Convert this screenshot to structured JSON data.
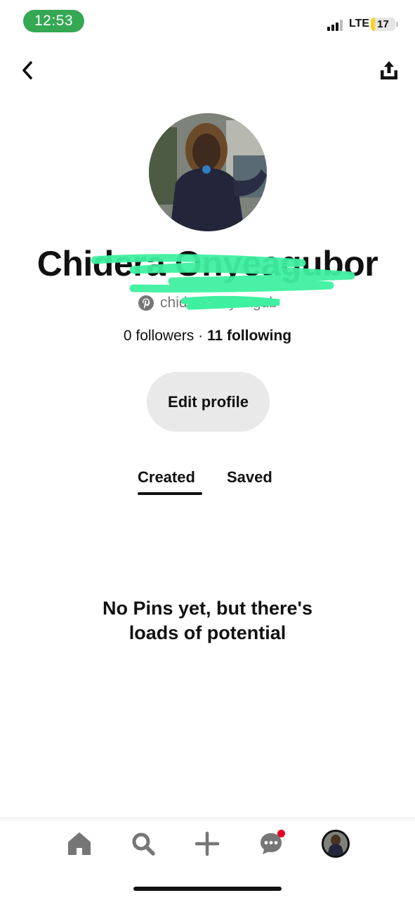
{
  "status_bar": {
    "time": "12:53",
    "network": "LTE",
    "battery_level": "17",
    "colors": {
      "time_pill": "#34a853",
      "battery_low": "#ffd21f"
    }
  },
  "header": {
    "back_icon": "chevron-left-icon",
    "share_icon": "share-upload-icon"
  },
  "profile": {
    "display_name": "Chidera Onyeagubor",
    "username": "chidera.onyeagub",
    "username_icon": "pinterest-logo-icon",
    "followers_label": "0 followers",
    "separator": "·",
    "following_label": "11 following",
    "edit_button_label": "Edit profile"
  },
  "tabs": [
    {
      "label": "Created",
      "active": true
    },
    {
      "label": "Saved",
      "active": false
    }
  ],
  "empty_state": {
    "line1": "No Pins yet, but there's",
    "line2": "loads of potential"
  },
  "bottom_nav": {
    "items": [
      {
        "name": "home",
        "icon": "home-icon"
      },
      {
        "name": "search",
        "icon": "search-icon"
      },
      {
        "name": "create",
        "icon": "plus-icon"
      },
      {
        "name": "messages",
        "icon": "chat-bubble-icon",
        "has_notification": true
      },
      {
        "name": "profile",
        "icon": "avatar"
      }
    ],
    "notification_color": "#e60023"
  }
}
